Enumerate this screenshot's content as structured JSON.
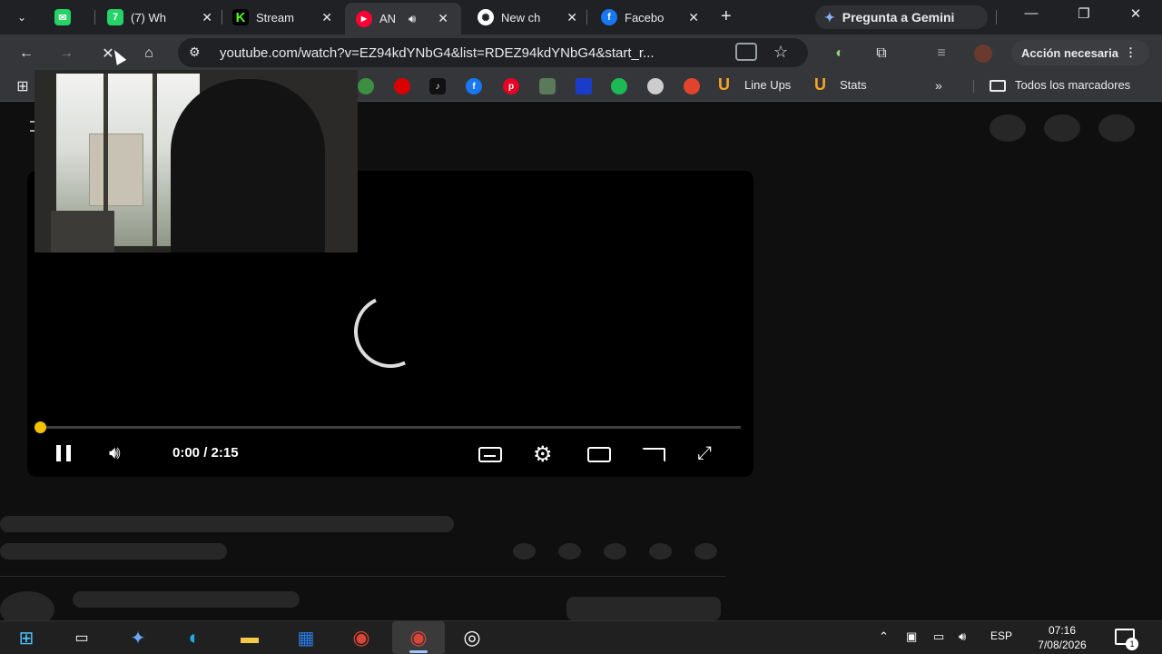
{
  "tabs": [
    {
      "title": "",
      "favicon": "whatsapp-multi-icon",
      "color": "#25d366",
      "glyph": "✉"
    },
    {
      "title": "(7) Wh",
      "favicon": "whatsapp-icon",
      "color": "#25d366",
      "glyph": "7"
    },
    {
      "title": "Stream",
      "favicon": "kick-icon",
      "color": "#53fc18",
      "glyph": "K"
    },
    {
      "title": "AN",
      "favicon": "youtube-music-icon",
      "color": "#ff0033",
      "glyph": "▶",
      "active": true
    },
    {
      "title": "New ch",
      "favicon": "chatgpt-icon",
      "color": "#ffffff",
      "glyph": "✺"
    },
    {
      "title": "Facebo",
      "favicon": "facebook-icon",
      "color": "#1877f2",
      "glyph": "f"
    }
  ],
  "new_tab_label": "+",
  "gemini_label": "Pregunta a Gemini",
  "window_controls": {
    "minimize": "—",
    "restore": "❐",
    "close": "✕"
  },
  "toolbar": {
    "url": "youtube.com/watch?v=EZ94kdYNbG4&list=RDEZ94kdYNbG4&start_r...",
    "accion_label": "Acción necesaria"
  },
  "bookmarks": {
    "items": [
      {
        "name": "green-site-icon",
        "color": "#3c8f40"
      },
      {
        "name": "red-site-icon",
        "color": "#d90000"
      },
      {
        "name": "tiktok-icon",
        "color": "#111111",
        "glyph": "♪"
      },
      {
        "name": "facebook-icon",
        "color": "#1877f2",
        "glyph": "f"
      },
      {
        "name": "pinterest-icon",
        "color": "#e60023",
        "glyph": "p"
      },
      {
        "name": "game-site-icon",
        "color": "#5a7a5a"
      },
      {
        "name": "blue-square-icon",
        "color": "#1a3cc8"
      },
      {
        "name": "spotify-icon",
        "color": "#1db954"
      },
      {
        "name": "chatgpt-icon",
        "color": "#cccccc"
      },
      {
        "name": "record-site-icon",
        "color": "#e0452c"
      }
    ],
    "line_ups_label": "Line Ups",
    "stats_label": "Stats",
    "all_bookmarks_label": "Todos los marcadores"
  },
  "player": {
    "time_display": "0:00 / 2:15",
    "progress": 0.0,
    "accent_color": "#f2c200",
    "state": "buffering"
  },
  "taskbar": {
    "apps": [
      {
        "name": "windows-start-icon",
        "glyph": "⊞",
        "color": "#4cc2ff"
      },
      {
        "name": "task-view-icon",
        "glyph": "▭",
        "color": "#ffffff"
      },
      {
        "name": "copilot-icon",
        "glyph": "✦",
        "color": "#6aa8ff"
      },
      {
        "name": "edge-icon",
        "glyph": "◐",
        "color": "#21a9e0"
      },
      {
        "name": "file-explorer-icon",
        "glyph": "▬",
        "color": "#f7c948"
      },
      {
        "name": "microsoft-store-icon",
        "glyph": "▦",
        "color": "#2b7de9"
      },
      {
        "name": "chrome-icon",
        "glyph": "◉",
        "color": "#db4437"
      },
      {
        "name": "chrome-profile-icon",
        "glyph": "◉",
        "color": "#db4437",
        "active": true
      },
      {
        "name": "obs-icon",
        "glyph": "◎",
        "color": "#ffffff"
      }
    ],
    "language": "ESP",
    "time": "07:16",
    "date": "7/08/2026",
    "notification_count": "1"
  }
}
